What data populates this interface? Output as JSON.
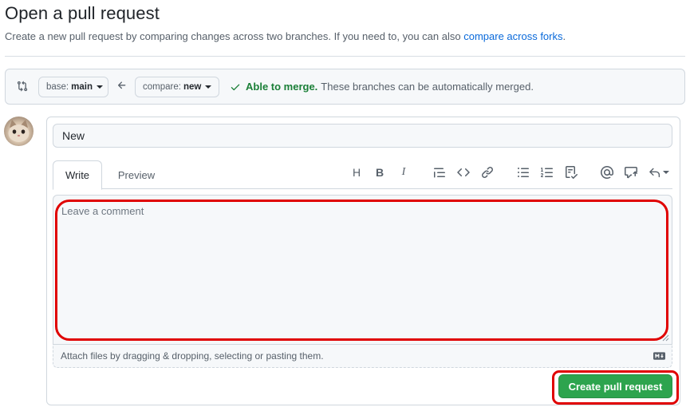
{
  "header": {
    "title": "Open a pull request",
    "subtitle_text": "Create a new pull request by comparing changes across two branches. If you need to, you can also",
    "subtitle_link": "compare across forks",
    "subtitle_end": "."
  },
  "compare_bar": {
    "base_prefix": "base:",
    "base_value": "main",
    "compare_prefix": "compare:",
    "compare_value": "new",
    "merge_ok": "Able to merge.",
    "merge_rest": "These branches can be automatically merged."
  },
  "form": {
    "title_value": "New",
    "tabs": [
      {
        "label": "Write",
        "active": true
      },
      {
        "label": "Preview",
        "active": false
      }
    ],
    "toolbar_icons": [
      "heading-icon",
      "bold-icon",
      "italic-icon",
      "quote-icon",
      "code-icon",
      "link-icon",
      "unordered-list-icon",
      "ordered-list-icon",
      "task-list-icon",
      "mention-icon",
      "reference-icon",
      "reply-dropdown-icon"
    ],
    "comment_placeholder": "Leave a comment",
    "attach_hint": "Attach files by dragging & dropping, selecting or pasting them.",
    "submit_label": "Create pull request"
  },
  "colors": {
    "accent_link": "#0969da",
    "success": "#1a7f37",
    "button_green": "#2da44e",
    "annotation_red": "#e00000"
  }
}
